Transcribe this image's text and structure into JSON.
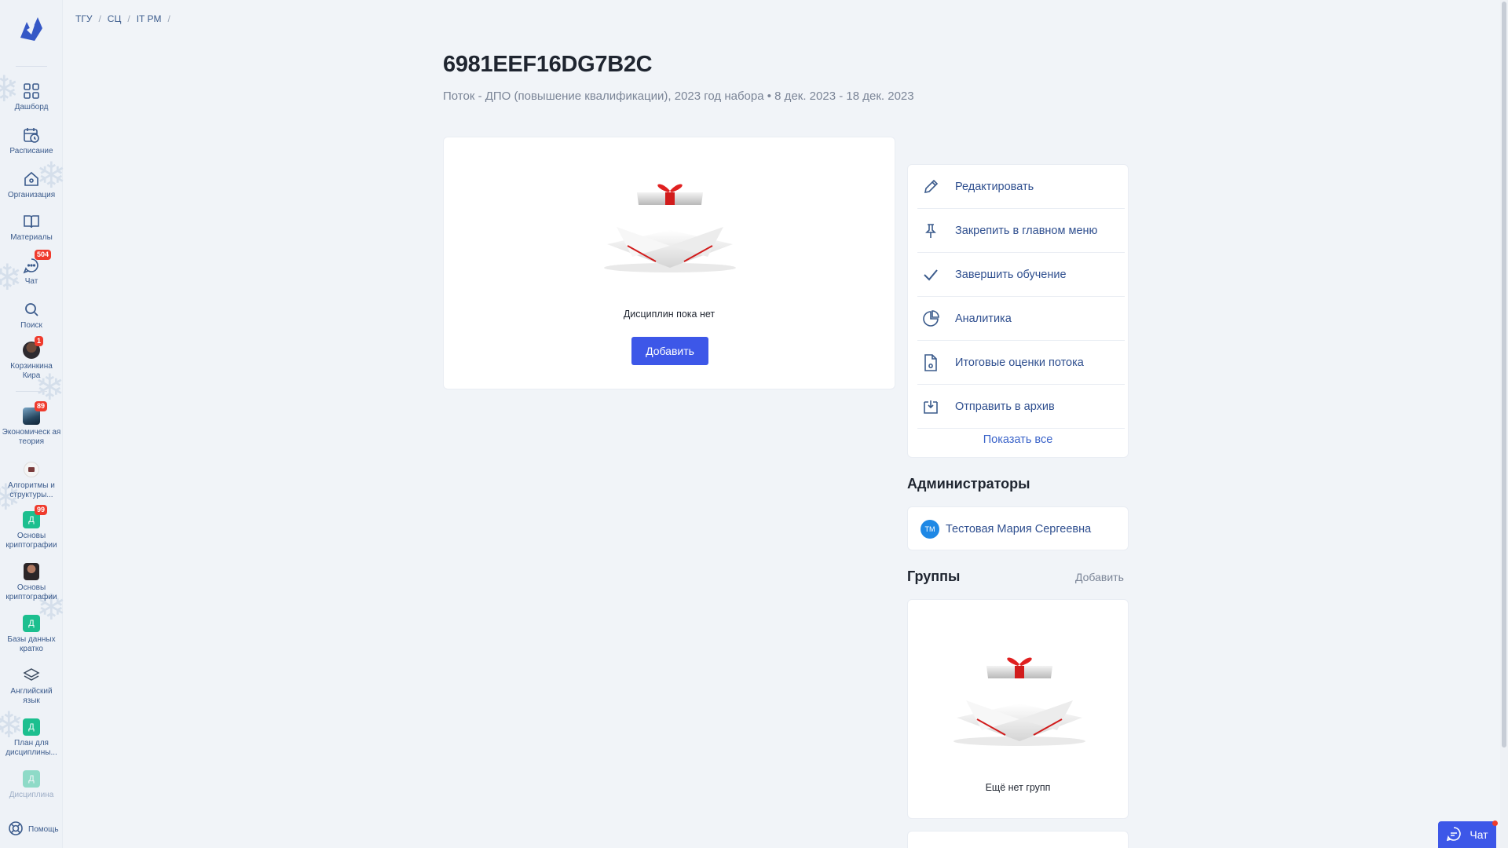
{
  "breadcrumb": [
    "ТГУ",
    "СЦ",
    "IT PM"
  ],
  "sidebar": {
    "items": [
      {
        "label": "Дашборд",
        "icon": "grid-icon"
      },
      {
        "label": "Расписание",
        "icon": "calendar-clock-icon"
      },
      {
        "label": "Организация",
        "icon": "home-icon"
      },
      {
        "label": "Материалы",
        "icon": "book-icon"
      },
      {
        "label": "Чат",
        "icon": "chat-icon",
        "badge": "504"
      },
      {
        "label": "Поиск",
        "icon": "search-icon"
      },
      {
        "label": "Корзинкина Кира",
        "icon": "user-avatar",
        "badge": "1"
      }
    ],
    "courses": [
      {
        "label": "Экономическ ая теория",
        "badge": "89",
        "icon": "course-image"
      },
      {
        "label": "Алгоритмы и структуры...",
        "icon": "course-image"
      },
      {
        "label": "Основы криптографии",
        "badge": "99",
        "tile": "Д"
      },
      {
        "label": "Основы криптографии",
        "icon": "course-image"
      },
      {
        "label": "Базы данных кратко",
        "tile": "Д"
      },
      {
        "label": "Английский язык",
        "icon": "layers-icon"
      },
      {
        "label": "План для дисциплины...",
        "tile": "Д"
      },
      {
        "label": "Дисциплина",
        "tile": "Д"
      }
    ],
    "help_label": "Помощь"
  },
  "page": {
    "title": "6981EEF16DG7B2C",
    "subtitle": "Поток - ДПО (повышение квалификации), 2023 год набора • 8 дек. 2023 - 18 дек. 2023"
  },
  "disciplines": {
    "empty_text": "Дисциплин пока нет",
    "add_label": "Добавить"
  },
  "actions": {
    "items": [
      {
        "label": "Редактировать",
        "icon": "pencil-icon"
      },
      {
        "label": "Закрепить в главном меню",
        "icon": "pin-icon"
      },
      {
        "label": "Завершить обучение",
        "icon": "check-icon"
      },
      {
        "label": "Аналитика",
        "icon": "pie-chart-icon"
      },
      {
        "label": "Итоговые оценки потока",
        "icon": "document-icon"
      },
      {
        "label": "Отправить в архив",
        "icon": "archive-icon"
      }
    ],
    "show_all": "Показать все"
  },
  "admins": {
    "title": "Администраторы",
    "list": [
      {
        "initials": "ТМ",
        "name": "Тестовая Мария Сергеевна"
      }
    ]
  },
  "groups": {
    "title": "Группы",
    "add_label": "Добавить",
    "empty_text": "Ещё нет групп"
  },
  "chat_widget": {
    "label": "Чат"
  },
  "colors": {
    "accent": "#3d57e8",
    "badge": "#ef3b2d",
    "tile": "#1cbf8f",
    "link": "#2f4f8f"
  }
}
